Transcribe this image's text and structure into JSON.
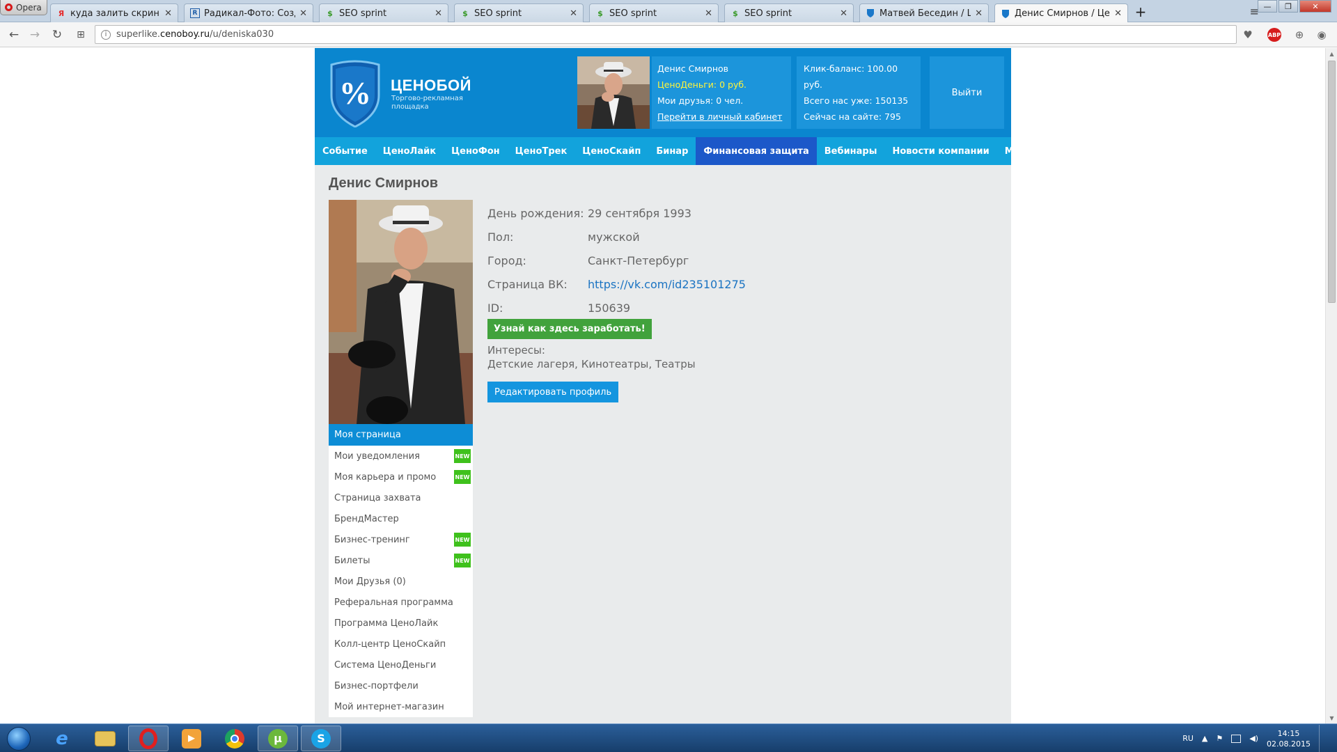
{
  "browser": {
    "menu_label": "Opera",
    "tabs": [
      {
        "title": "куда залить скриншот и с",
        "favicon": "yandex-icon",
        "active": false
      },
      {
        "title": "Радикал-Фото: Создай ф",
        "favicon": "radikal-icon",
        "active": false
      },
      {
        "title": "SEO sprint",
        "favicon": "seosprint-icon",
        "active": false
      },
      {
        "title": "SEO sprint",
        "favicon": "seosprint-icon",
        "active": false
      },
      {
        "title": "SEO sprint",
        "favicon": "seosprint-icon",
        "active": false
      },
      {
        "title": "SEO sprint",
        "favicon": "seosprint-icon",
        "active": false
      },
      {
        "title": "Матвей Беседин / Ценоб",
        "favicon": "shield-icon",
        "active": false
      },
      {
        "title": "Денис Смирнов / Ценобо",
        "favicon": "shield-icon",
        "active": true
      }
    ],
    "address": {
      "prefix": "superlike.",
      "host": "cenoboy.ru",
      "path": "/u/deniska030"
    },
    "abp_label": "ABP"
  },
  "site": {
    "logo": {
      "name": "ЦЕНОБОЙ",
      "subtitle": "Торгово-рекламная площадка",
      "mark": "%"
    },
    "user": {
      "name": "Денис Смирнов",
      "money": "ЦеноДеньги: 0 руб.",
      "friends": "Мои друзья: 0 чел.",
      "cabinet_link": "Перейти в личный кабинет"
    },
    "stats": {
      "balance": "Клик-баланс: 100.00 руб.",
      "total": "Всего нас уже: 150135",
      "online": "Сейчас на сайте: 795"
    },
    "logout": "Выйти",
    "menu": [
      {
        "label": "Событие",
        "active": false
      },
      {
        "label": "ЦеноЛайк",
        "active": false
      },
      {
        "label": "ЦеноФон",
        "active": false
      },
      {
        "label": "ЦеноТрек",
        "active": false
      },
      {
        "label": "ЦеноСкайп",
        "active": false
      },
      {
        "label": "Бинар",
        "active": false
      },
      {
        "label": "Финансовая защита",
        "active": true
      },
      {
        "label": "Вебинары",
        "active": false
      },
      {
        "label": "Новости компании",
        "active": false
      },
      {
        "label": "Марафон",
        "active": false
      }
    ],
    "colors": {
      "header": "#0a86cf",
      "menu": "#12a3dc",
      "menu_active": "#1c58c9",
      "money": "#fff43a",
      "new_badge": "#3fc11c",
      "earn_button": "#41a23c"
    }
  },
  "profile": {
    "title": "Денис Смирнов",
    "fields": [
      {
        "label": "День рождения:",
        "value": "29 сентября 1993"
      },
      {
        "label": "Пол:",
        "value": "мужской"
      },
      {
        "label": "Город:",
        "value": "Санкт-Петербург"
      },
      {
        "label": "Страница ВК:",
        "value": "https://vk.com/id235101275",
        "link": true
      },
      {
        "label": "ID:",
        "value": "150639"
      }
    ],
    "earn_button": "Узнай как здесь заработать!",
    "interests_label": "Интересы:",
    "interests": "Детские лагеря, Кинотеатры, Театры",
    "edit_button": "Редактировать профиль"
  },
  "sidebar": {
    "header": "Моя страница",
    "new_badge": "NEW",
    "items": [
      {
        "label": "Мои уведомления",
        "new": true
      },
      {
        "label": "Моя карьера и промо",
        "new": true
      },
      {
        "label": "Страница захвата",
        "new": false
      },
      {
        "label": "БрендМастер",
        "new": false
      },
      {
        "label": "Бизнес-тренинг",
        "new": true
      },
      {
        "label": "Билеты",
        "new": true
      },
      {
        "label": "Мои Друзья (0)",
        "new": false
      },
      {
        "label": "Реферальная программа",
        "new": false
      },
      {
        "label": "Программа ЦеноЛайк",
        "new": false
      },
      {
        "label": "Колл-центр ЦеноСкайп",
        "new": false
      },
      {
        "label": "Система ЦеноДеньги",
        "new": false
      },
      {
        "label": "Бизнес-портфели",
        "new": false
      },
      {
        "label": "Мой интернет-магазин",
        "new": false
      }
    ]
  },
  "taskbar": {
    "apps": [
      "internet-explorer-icon",
      "folder-icon",
      "opera-icon",
      "media-player-icon",
      "chrome-icon",
      "utorrent-icon",
      "skype-icon"
    ],
    "language": "RU",
    "time": "14:15",
    "date": "02.08.2015"
  }
}
